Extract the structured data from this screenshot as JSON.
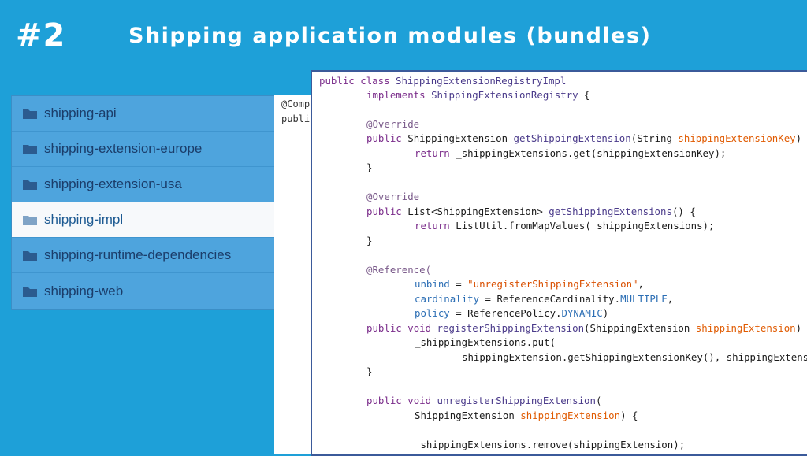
{
  "header": {
    "slide_number": "#2",
    "title": "Shipping application modules (bundles)"
  },
  "modules": [
    {
      "label": "shipping-api",
      "active": false
    },
    {
      "label": "shipping-extension-europe",
      "active": false
    },
    {
      "label": "shipping-extension-usa",
      "active": false
    },
    {
      "label": "shipping-impl",
      "active": true
    },
    {
      "label": "shipping-runtime-dependencies",
      "active": false
    },
    {
      "label": "shipping-web",
      "active": false
    }
  ],
  "behind_doc": {
    "line1": "@Comp",
    "line2": "publi"
  },
  "code": {
    "l1_public": "public",
    "l1_class": "class",
    "l1_name": "ShippingExtensionRegistryImpl",
    "l2_implements": "implements",
    "l2_iface": "ShippingExtensionRegistry",
    "l2_brace": "{",
    "l3_ann": "@Override",
    "l4_public": "public",
    "l4_type": "ShippingExtension",
    "l4_method": "getShippingExtension",
    "l4_open": "(String ",
    "l4_param": "shippingExtensionKey",
    "l4_close": ")",
    "l5_return": "return",
    "l5_rest": "_shippingExtensions.get(shippingExtensionKey);",
    "l6_brace": "}",
    "l7_ann": "@Override",
    "l8_public": "public",
    "l8_type": "List<ShippingExtension>",
    "l8_method": "getShippingExtensions",
    "l8_rest": "() {",
    "l9_return": "return",
    "l9_rest": "ListUtil.fromMapValues( shippingExtensions);",
    "l10_brace": "}",
    "l11_ann": "@Reference(",
    "l12_attr": "unbind",
    "l12_eq": " = ",
    "l12_str": "\"unregisterShippingExtension\"",
    "l12_comma": ",",
    "l13_attr": "cardinality",
    "l13_eq": " = ReferenceCardinality.",
    "l13_const": "MULTIPLE",
    "l13_comma": ",",
    "l14_attr": "policy",
    "l14_eq": " = ReferencePolicy.",
    "l14_const": "DYNAMIC",
    "l14_close": ")",
    "l15_public": "public",
    "l15_void": "void",
    "l15_method": "registerShippingExtension",
    "l15_open": "(ShippingExtension ",
    "l15_param": "shippingExtension",
    "l15_close": ")",
    "l16_text": "_shippingExtensions.put(",
    "l17_text": "shippingExtension.getShippingExtensionKey(), shippingExtens",
    "l18_brace": "}",
    "l19_public": "public",
    "l19_void": "void",
    "l19_method": "unregisterShippingExtension",
    "l19_open": "(",
    "l20_type": "ShippingExtension ",
    "l20_param": "shippingExtension",
    "l20_rest": ") {",
    "l21_text": "_shippingExtensions.remove(shippingExtension);"
  },
  "colors": {
    "background": "#1ea0d8",
    "panel": "#4ea4dd",
    "active_item": "#f7f9fb",
    "keyword": "#7b2d8b",
    "parameter": "#e05a00"
  },
  "icons": [
    "folder-icon"
  ]
}
